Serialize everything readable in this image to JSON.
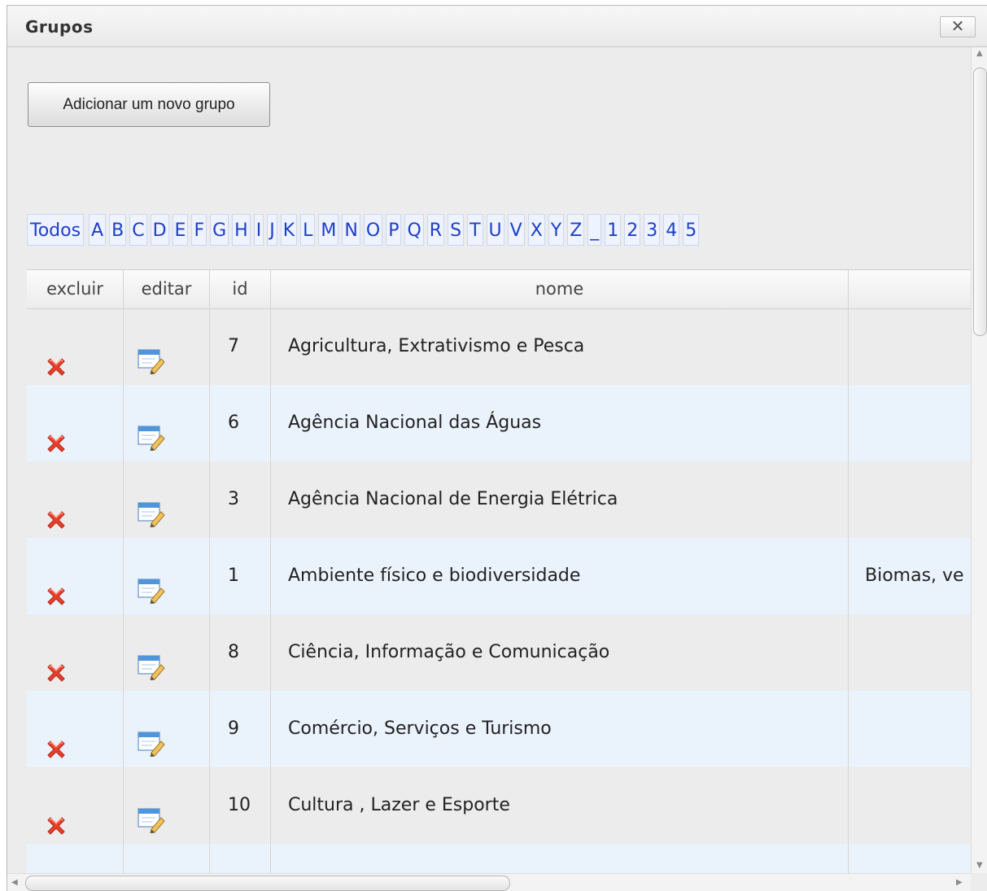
{
  "dialog": {
    "title": "Grupos",
    "close_label": "✕"
  },
  "toolbar": {
    "add_label": "Adicionar um novo grupo"
  },
  "alpha_filter": {
    "all_label": "Todos",
    "letters": [
      "A",
      "B",
      "C",
      "D",
      "E",
      "F",
      "G",
      "H",
      "I",
      "J",
      "K",
      "L",
      "M",
      "N",
      "O",
      "P",
      "Q",
      "R",
      "S",
      "T",
      "U",
      "V",
      "X",
      "Y",
      "Z",
      "_",
      "1",
      "2",
      "3",
      "4",
      "5"
    ]
  },
  "table": {
    "headers": {
      "excluir": "excluir",
      "editar": "editar",
      "id": "id",
      "nome": "nome",
      "descricao": ""
    },
    "rows": [
      {
        "id": "7",
        "nome": "Agricultura, Extrativismo e Pesca",
        "descricao": ""
      },
      {
        "id": "6",
        "nome": "Agência Nacional das Águas",
        "descricao": ""
      },
      {
        "id": "3",
        "nome": "Agência Nacional de Energia Elétrica",
        "descricao": ""
      },
      {
        "id": "1",
        "nome": "Ambiente físico e biodiversidade",
        "descricao": "Biomas, ve"
      },
      {
        "id": "8",
        "nome": "Ciência, Informação e Comunicação",
        "descricao": ""
      },
      {
        "id": "9",
        "nome": "Comércio, Serviços e Turismo",
        "descricao": ""
      },
      {
        "id": "10",
        "nome": "Cultura , Lazer e Esporte",
        "descricao": ""
      },
      {
        "id": "",
        "nome": "",
        "descricao": ""
      }
    ]
  },
  "icons": {
    "delete": "delete-x-icon",
    "edit": "edit-pencil-icon"
  },
  "colors": {
    "link": "#1e3fc8",
    "row_alt": "#eaf2fb",
    "delete_red": "#e8402a"
  }
}
